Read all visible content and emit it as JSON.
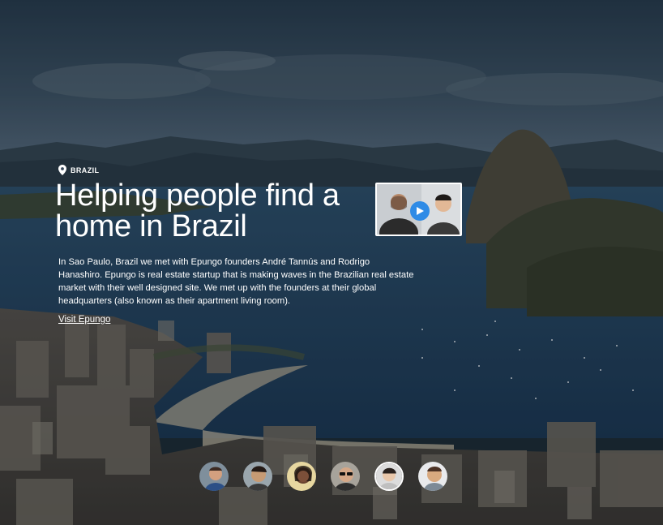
{
  "location": {
    "label": "BRAZIL",
    "icon": "map-pin-icon"
  },
  "headline": "Helping people find a home in Brazil",
  "video": {
    "icon": "play-icon",
    "accent": "#2f8be6"
  },
  "description": "In Sao Paulo, Brazil we met with Epungo founders André Tannús and Rodrigo Hanashiro. Epungo is real estate startup that is making waves in the Brazilian real estate market with their well designed site. We met up with the founders at their global headquarters (also known as their apartment living room).",
  "link": {
    "label": "Visit Epungo"
  },
  "avatars": {
    "count": 6,
    "active_index": 4
  }
}
